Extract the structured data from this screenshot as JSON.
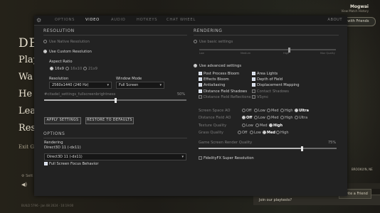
{
  "background": {
    "logo": "DE",
    "menu": [
      "Play",
      "Wa",
      "He",
      "Lea",
      "Res"
    ],
    "exit": "Exit G",
    "settings_label": "Sett",
    "speaker_icon": "speaker-icon",
    "version": "BUILD 5796 · Jan 08 2024 · 10:19:00",
    "user_name": "Mogwai",
    "user_sub": "View Match History",
    "friends_button": "g with Friends",
    "location": "BROOKLYN, NE",
    "playtests": "Join our playtests?",
    "invite": "Invite a Friend"
  },
  "tabs": {
    "gear_icon": "gear-icon",
    "items": [
      "OPTIONS",
      "VIDEO",
      "AUDIO",
      "HOTKEYS",
      "CHAT WHEEL"
    ],
    "active": "VIDEO",
    "about": "ABOUT"
  },
  "resolution": {
    "header": "RESOLUTION",
    "native": "Use Native Resolution",
    "custom": "Use Custom Resolution",
    "aspect_label": "Aspect Ratio",
    "aspect_options": [
      "16x9",
      "16x10",
      "21x9"
    ],
    "aspect_selected": "16x9",
    "res_label": "Resolution",
    "res_value": "2560x1440 (240 Hz)",
    "window_label": "Window Mode",
    "window_value": "Full Screen",
    "brightness_label": "#citadel_settings_fullscreenbrightness",
    "brightness_value": "50%",
    "brightness_level": 0.5,
    "apply": "APPLY SETTINGS",
    "restore": "RESTORE TO DEFAULTS"
  },
  "options": {
    "header": "OPTIONS",
    "rendering_label": "Rendering",
    "rendering_current": "Direct3D 11 (-dx11)",
    "rendering_value": "Direct3D 11 (-dx11)",
    "fs_focus": "Full Screen Focus Behavior"
  },
  "rendering": {
    "header": "RENDERING",
    "basic": "Use basic settings",
    "basic_ticks": [
      "Low",
      "Medium",
      "High",
      "Max Quality"
    ],
    "basic_level": 0.66,
    "advanced": "Use advanced settings",
    "checks_left": [
      {
        "label": "Post Process Bloom",
        "on": true
      },
      {
        "label": "Effects Bloom",
        "on": true
      },
      {
        "label": "Antialiasing",
        "on": true
      },
      {
        "label": "Distance Field Shadows",
        "on": true
      },
      {
        "label": "Distance Field Reflections",
        "on": false
      }
    ],
    "checks_right": [
      {
        "label": "Area Lights",
        "on": true
      },
      {
        "label": "Depth of Field",
        "on": true
      },
      {
        "label": "Displacement Mapping",
        "on": true
      },
      {
        "label": "Contact Shadows",
        "on": false
      },
      {
        "label": "VSync",
        "on": false
      }
    ],
    "ao_label": "Screen Space AO",
    "ao_options": [
      "Off",
      "Low",
      "Med",
      "High",
      "Ultra"
    ],
    "ao_selected": "Ultra",
    "dfao_label": "Distance Field AO",
    "dfao_options": [
      "Off",
      "Low",
      "Med",
      "High",
      "Ultra"
    ],
    "dfao_selected": "Off",
    "texture_label": "Texture Quality",
    "texture_options": [
      "Low",
      "Med",
      "High"
    ],
    "texture_selected": "High",
    "grass_label": "Grass Quality",
    "grass_options": [
      "Off",
      "Low",
      "Med",
      "High"
    ],
    "grass_selected": "Med",
    "grr_label": "Game Screen Render Quality",
    "grr_value": "75%",
    "grr_level": 0.75,
    "fsr": "FidelityFX Super Resolution",
    "fsr_on": false
  },
  "colors": {
    "panel": "#222222",
    "checked": "#cfd8e8",
    "accent_text": "#ffffff"
  }
}
